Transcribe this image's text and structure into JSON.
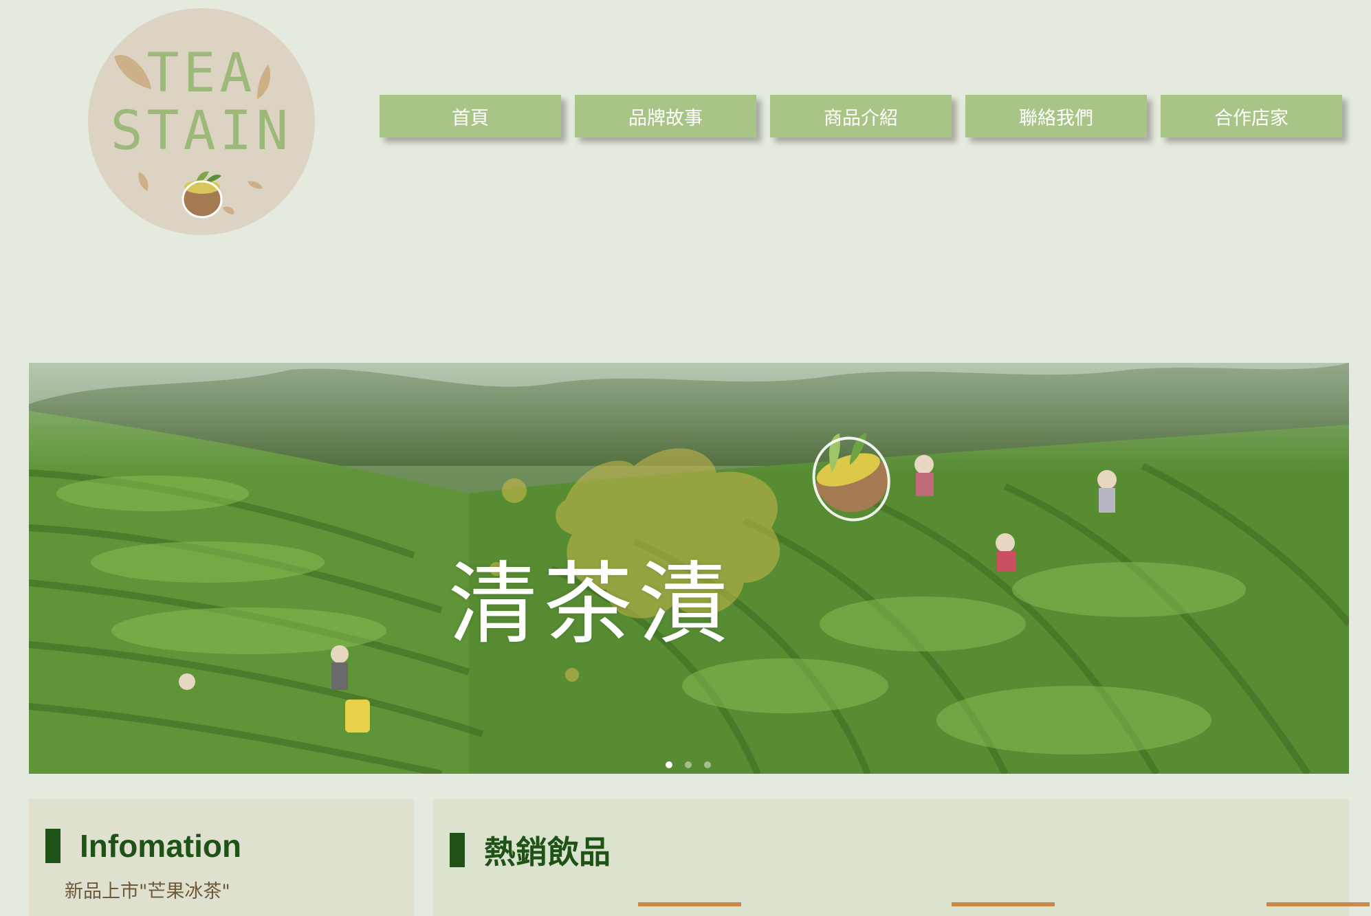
{
  "logo": {
    "line1": "TEA",
    "line2": "STAIN"
  },
  "nav": {
    "items": [
      {
        "label": "首頁"
      },
      {
        "label": "品牌故事"
      },
      {
        "label": "商品介紹"
      },
      {
        "label": "聯絡我們"
      },
      {
        "label": "合作店家"
      }
    ]
  },
  "hero": {
    "title": "清茶漬",
    "slides": 3,
    "active_slide": 1
  },
  "info": {
    "title": "Infomation",
    "items": [
      "新品上市\"芒果冰茶\""
    ]
  },
  "hot": {
    "title": "熱銷飲品"
  },
  "colors": {
    "background": "#e5eade",
    "nav": "#a8c486",
    "accent_dark_green": "#1e5216",
    "logo_circle": "#dcd3c3"
  }
}
